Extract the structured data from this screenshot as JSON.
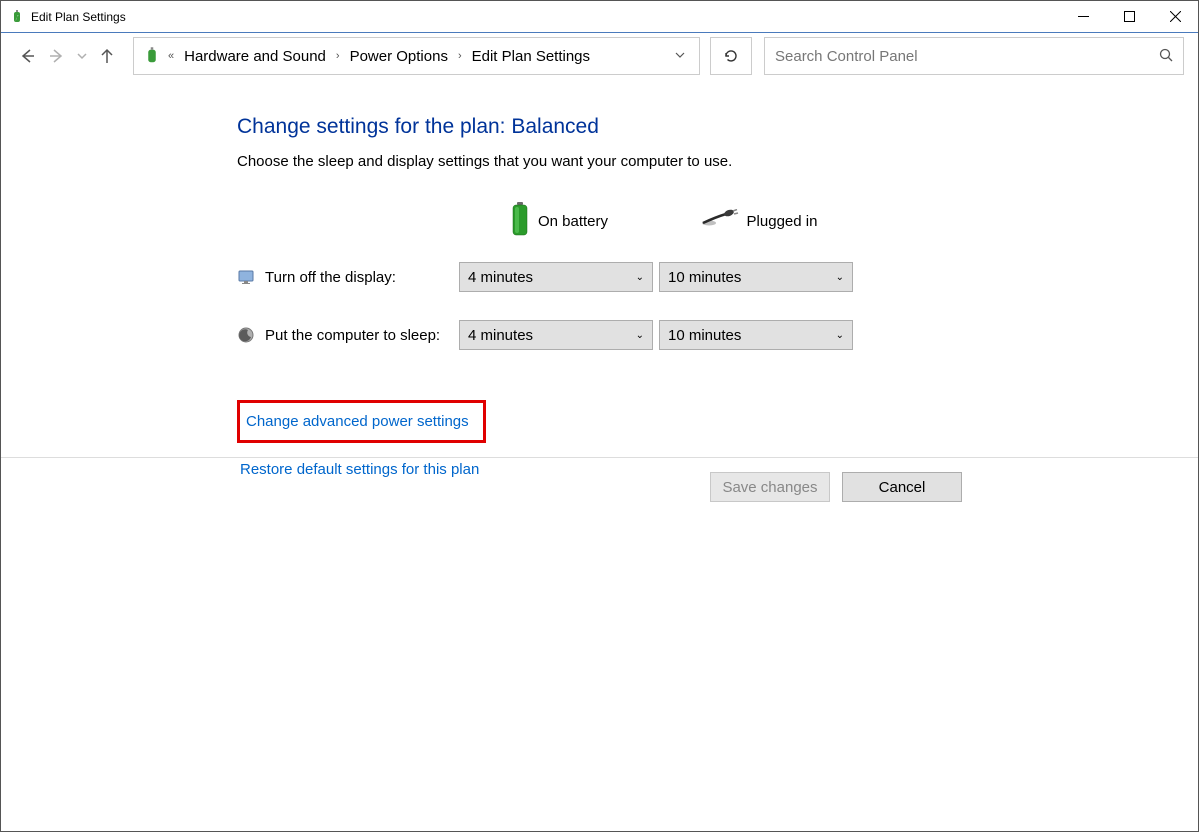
{
  "window": {
    "title": "Edit Plan Settings"
  },
  "breadcrumb": {
    "items": [
      "Hardware and Sound",
      "Power Options",
      "Edit Plan Settings"
    ]
  },
  "search": {
    "placeholder": "Search Control Panel"
  },
  "page": {
    "title": "Change settings for the plan: Balanced",
    "description": "Choose the sleep and display settings that you want your computer to use."
  },
  "columns": {
    "battery": "On battery",
    "plugged": "Plugged in"
  },
  "settings": [
    {
      "label": "Turn off the display:",
      "battery_value": "4 minutes",
      "plugged_value": "10 minutes"
    },
    {
      "label": "Put the computer to sleep:",
      "battery_value": "4 minutes",
      "plugged_value": "10 minutes"
    }
  ],
  "links": {
    "advanced": "Change advanced power settings",
    "restore": "Restore default settings for this plan"
  },
  "buttons": {
    "save": "Save changes",
    "cancel": "Cancel"
  }
}
